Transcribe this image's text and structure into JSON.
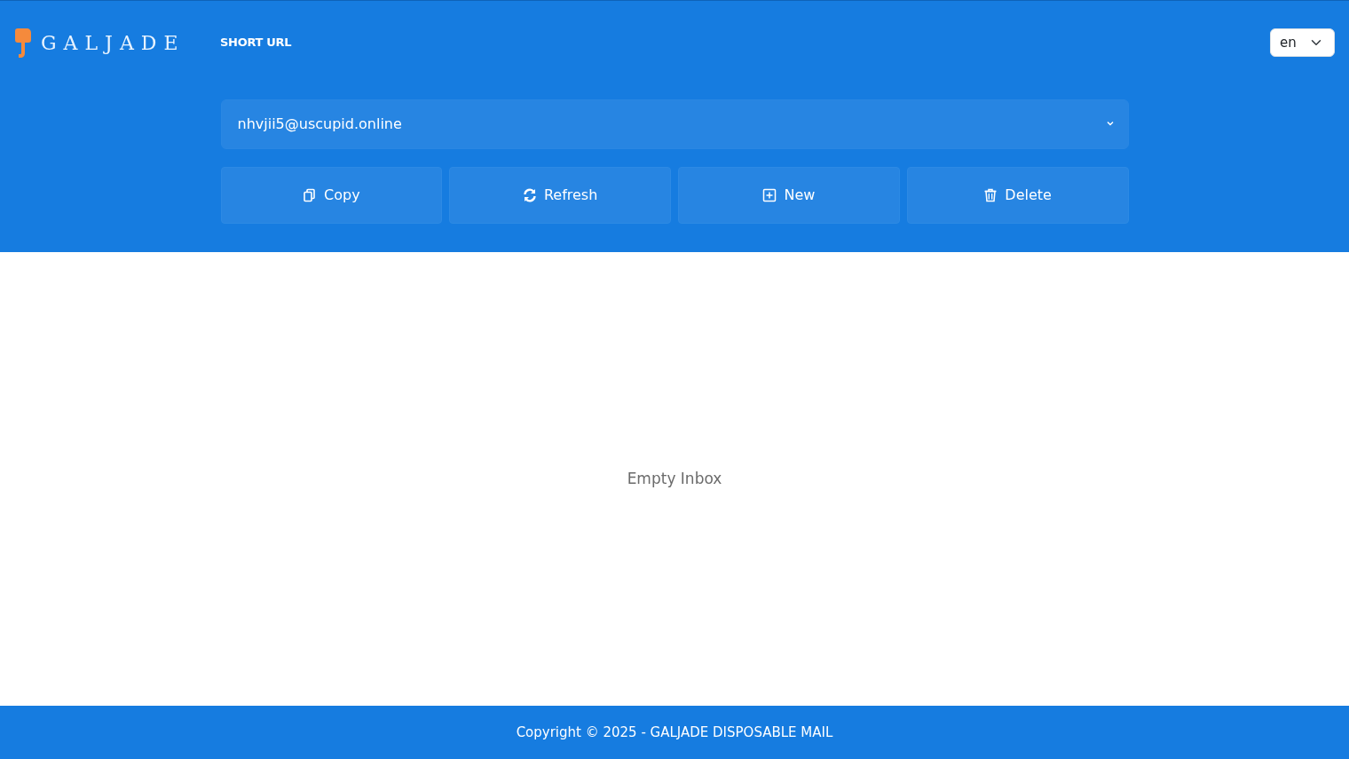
{
  "brand": {
    "name": "GALJADE"
  },
  "nav": [
    {
      "label": "SHORT URL"
    }
  ],
  "language": {
    "value": "en"
  },
  "email": {
    "value": "nhvjii5@uscupid.online"
  },
  "buttons": [
    {
      "label": "Copy",
      "kind": "copy"
    },
    {
      "label": "Refresh",
      "kind": "refresh"
    },
    {
      "label": "New",
      "kind": "new"
    },
    {
      "label": "Delete",
      "kind": "delete"
    }
  ],
  "inbox": {
    "message": "Empty Inbox"
  },
  "footer": {
    "text": "Copyright © 2025 - GALJADE DISPOSABLE MAIL"
  }
}
